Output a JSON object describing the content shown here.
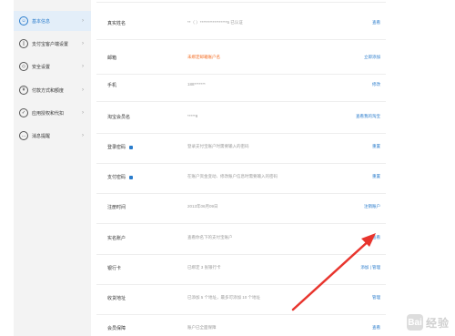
{
  "sidebar": {
    "items": [
      {
        "label": "基本信息",
        "icon": "user-icon",
        "active": true
      },
      {
        "label": "支付宝客户端设置",
        "icon": "phone-icon",
        "active": false
      },
      {
        "label": "安全设置",
        "icon": "shield-icon",
        "active": false
      },
      {
        "label": "付款方式和额度",
        "icon": "wallet-icon",
        "active": false
      },
      {
        "label": "应用授权和代扣",
        "icon": "check-icon",
        "active": false
      },
      {
        "label": "消息提醒",
        "icon": "message-icon",
        "active": false
      }
    ]
  },
  "rows": [
    {
      "label": "真实姓名",
      "value": "**（ ）*****************5 已认证",
      "action": "查看",
      "lock": false
    },
    {
      "label": "邮箱",
      "value": "未绑定邮箱账户名",
      "value_style": "warn",
      "action": "立即添加",
      "lock": false
    },
    {
      "label": "手机",
      "value": "188*******",
      "action": "修改",
      "lock": false
    },
    {
      "label": "淘宝会员名",
      "value": "*****9",
      "action": "查看我的淘宝",
      "lock": false
    },
    {
      "label": "登录密码",
      "value": "登录支付宝账户时需要输入的密码",
      "action": "重置",
      "lock": true
    },
    {
      "label": "支付密码",
      "value": "在账户资金变动、修改账户信息时需要输入的密码",
      "action": "重置",
      "lock": true
    },
    {
      "label": "注册时间",
      "value": "2013年06月09日",
      "action": "注销账户",
      "lock": false
    },
    {
      "label": "实名账户",
      "value": "查看你名下的支付宝账户",
      "action": "查看",
      "lock": false
    },
    {
      "label": "银行卡",
      "value": "已绑定 3 张银行卡",
      "action": "添加 | 管理",
      "lock": false
    },
    {
      "label": "收货地址",
      "value": "已添加 5 个地址，最多可添加 10 个地址",
      "action": "管理",
      "lock": false
    },
    {
      "label": "会员保障",
      "value": "账户已全面保障",
      "action": "查看",
      "lock": false
    }
  ],
  "watermark": {
    "badge": "Bai",
    "text": "经验"
  },
  "colors": {
    "accent": "#2a7ccc",
    "warn": "#f36a1f",
    "arrow": "#e8352e"
  }
}
